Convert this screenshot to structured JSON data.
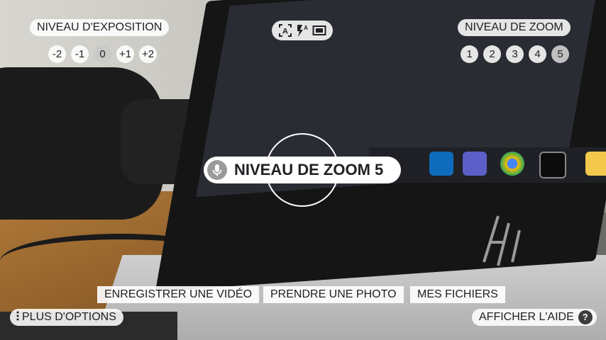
{
  "exposure": {
    "label": "NIVEAU D'EXPOSITION",
    "levels": [
      "-2",
      "-1",
      "0",
      "+1",
      "+2"
    ],
    "selected": "0"
  },
  "zoom": {
    "label": "NIVEAU DE ZOOM",
    "levels": [
      "1",
      "2",
      "3",
      "4",
      "5"
    ],
    "selected": "5"
  },
  "mode_icons": [
    "text-scan-icon",
    "flash-auto-icon",
    "aspect-ratio-icon"
  ],
  "toast": {
    "text": "NIVEAU DE ZOOM 5",
    "icon": "microphone-icon"
  },
  "actions": {
    "record_video": "ENREGISTRER UNE VIDÉO",
    "take_photo": "PRENDRE UNE PHOTO",
    "my_files": "MES FICHIERS"
  },
  "more_options": "PLUS D'OPTIONS",
  "show_help": "AFFICHER L'AIDE",
  "help_glyph": "?",
  "colors": {
    "overlay_bg": "#ffffff",
    "text": "#202124",
    "selected_level": "#c8c8c8"
  }
}
